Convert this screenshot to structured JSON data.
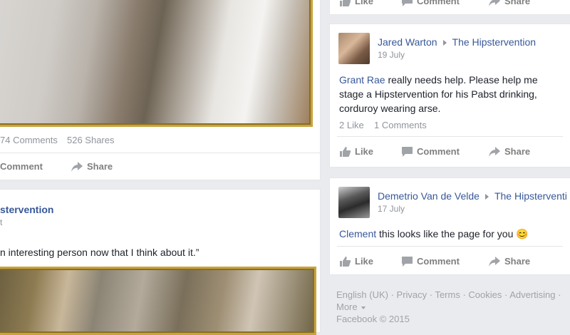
{
  "left_post_top": {
    "stats": {
      "comments": "74 Comments",
      "shares": "526 Shares"
    },
    "actions": {
      "comment": "Comment",
      "share": "Share"
    }
  },
  "left_post_bottom": {
    "group": "stervention",
    "meta": "t",
    "quote": "n interesting person now that I think about it.”"
  },
  "right_post_top_partial": {
    "actions": {
      "like": "Like",
      "comment": "Comment",
      "share": "Share"
    }
  },
  "right_post_1": {
    "author": "Jared Warton",
    "group": "The Hipstervention",
    "date": "19 July",
    "mention": "Grant Rae",
    "text_after_mention": " really needs help. Please help me stage a Hipstervention for his Pabst drinking, corduroy wearing arse.",
    "stats": {
      "likes": "2 Like",
      "comments": "1 Comments"
    },
    "actions": {
      "like": "Like",
      "comment": "Comment",
      "share": "Share"
    }
  },
  "right_post_2": {
    "author": "Demetrio Van de Velde",
    "group": "The Hipsterventi",
    "date": "17 July",
    "mention": "Clement",
    "text_after_mention": " this looks like the page for you ",
    "emoji": "😊",
    "actions": {
      "like": "Like",
      "comment": "Comment",
      "share": "Share"
    }
  },
  "footer": {
    "line1": "English (UK) · Privacy · Terms · Cookies · Advertising ·",
    "more": "More",
    "copyright": "Facebook © 2015"
  },
  "colors": {
    "link": "#385898",
    "background": "#e9ebee",
    "frame": "#c9a43c"
  }
}
